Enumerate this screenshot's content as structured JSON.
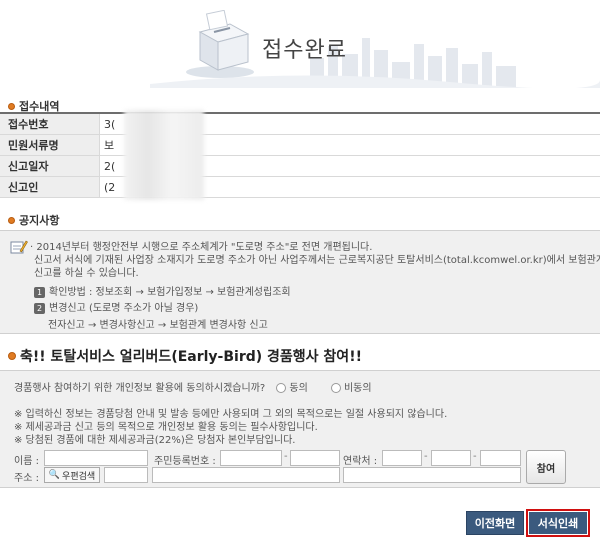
{
  "header": {
    "title": "접수완료"
  },
  "receipt": {
    "section_title": "접수내역",
    "rows": [
      {
        "label": "접수번호",
        "value": "3("
      },
      {
        "label": "민원서류명",
        "value": "보"
      },
      {
        "label": "신고일자",
        "value": "2("
      },
      {
        "label": "신고인",
        "value": "(2"
      }
    ]
  },
  "notice": {
    "section_title": "공지사항",
    "line1": "· 2014년부터 행정안전부 시행으로 주소체계가 \"도로명 주소\"로 전면 개편됩니다.",
    "line2": "신고서 서식에 기재된 사업장 소재지가 도로명 주소가 아닌 사업주께서는 근로복지공단 토탈서비스(total.kcomwel.or.kr)에서 보험관계 변경",
    "line3": "신고를 하실 수 있습니다.",
    "step1_num": "1",
    "step1": "확인방법 :  정보조회 → 보험가입정보 → 보험관계성립조회",
    "step2_num": "2",
    "step2": "변경신고 (도로명 주소가 아닐 경우)",
    "step3": "전자신고 → 변경사항신고 → 보험관계 변경사항 신고"
  },
  "event": {
    "title": "축!! 토탈서비스 얼리버드(Early-Bird) 경품행사 참여!!",
    "consent_question": "경품행사 참여하기 위한 개인정보 활용에 동의하시겠습니까?",
    "agree_label": "동의",
    "disagree_label": "비동의",
    "note1": "※ 입력하신 정보는 경품당첨 안내 및 발송 등에만 사용되며 그 외의 목적으로는 일절 사용되지 않습니다.",
    "note2": "※ 제세공과금 신고 등의 목적으로 개인정보 활용 동의는 필수사항입니다.",
    "note3": "※ 당첨된 경품에 대한 제세공과금(22%)은 당첨자 본인부담입니다.",
    "name_label": "이름 :",
    "rrn_label": "주민등록번호 :",
    "contact_label": "연락처 :",
    "address_label": "주소 :",
    "zip_button": "우편검색",
    "join_button": "참여",
    "dash": "-"
  },
  "buttons": {
    "prev": "이전화면",
    "print": "서식인쇄"
  },
  "colors": {
    "button_bg": "#3b5a7e",
    "highlight_border": "#d01010",
    "bullet": "#e07b22"
  }
}
